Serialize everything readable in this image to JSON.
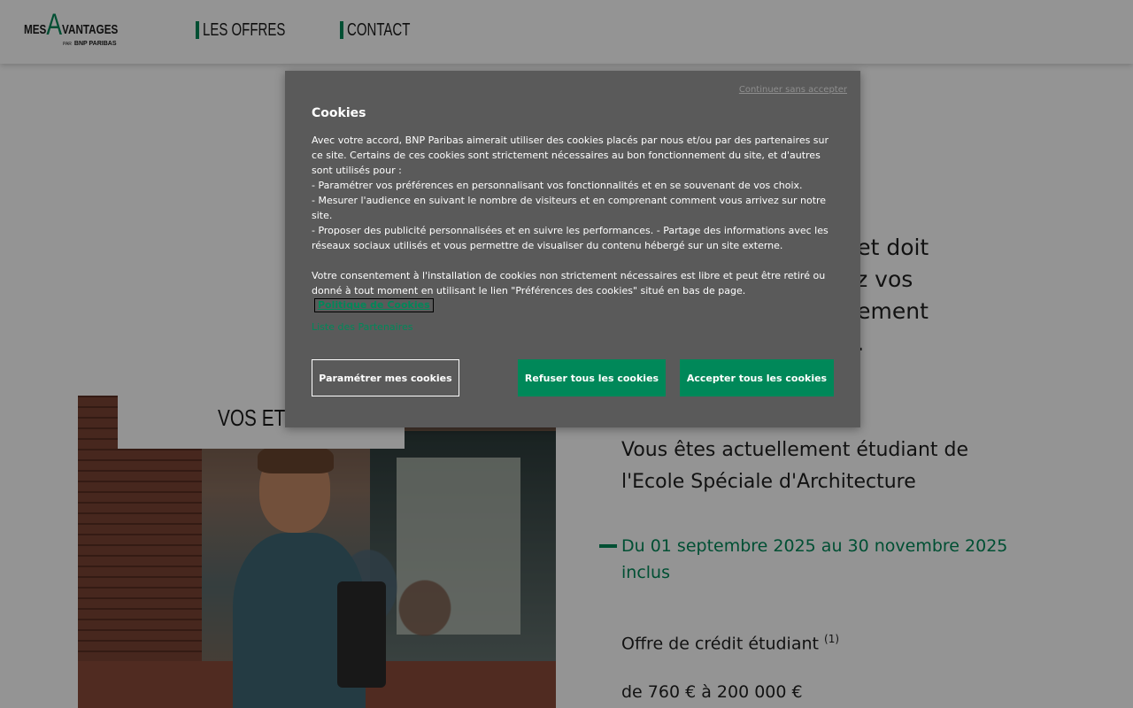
{
  "header": {
    "logo": {
      "mes": "MES",
      "a": "A",
      "vantages": "VANTAGES",
      "par": "PAR",
      "brand": "BNP PARIBAS"
    },
    "nav": [
      {
        "label": "LES OFFRES"
      },
      {
        "label": "CONTACT"
      }
    ]
  },
  "main": {
    "intro_visible": "ge et doit\nifiez vos\nursement\nger.",
    "card_title": "VOS ETUD",
    "status": "Vous êtes actuellement étudiant de l'Ecole Spéciale d'Architecture",
    "dates": "Du 01 septembre 2025 au 30 novembre 2025 inclus",
    "offer": "Offre de  crédit étudiant",
    "offer_note": "(1)",
    "amount": "de 760 € à 200 000 €"
  },
  "cookie_modal": {
    "skip_link": "Continuer sans accepter",
    "title": "Cookies",
    "body": [
      "Avec votre accord, BNP Paribas aimerait utiliser des cookies placés par nous et/ou par des partenaires sur ce site. Certains de ces cookies sont strictement nécessaires au bon fonctionnement du site, et d'autres sont utilisés pour :",
      "- Paramétrer vos préférences en personnalisant vos fonctionnalités et en se souvenant de vos choix.",
      "- Mesurer l'audience en suivant le nombre de visiteurs et en comprenant comment vous arrivez sur notre site.",
      "- Proposer des publicité personnalisées et en suivre les performances. - Partage des informations avec les réseaux sociaux utilisés et vous permettre de visualiser du contenu hébergé sur un site externe.",
      "Votre consentement à l'installation de cookies non strictement nécessaires est libre et peut être retiré ou donné à tout moment en utilisant le lien \"Préférences des cookies\" situé en bas de page."
    ],
    "policy_link": "Politique de Cookies",
    "partners_link": "Liste des Partenaires",
    "buttons": {
      "settings": "Paramétrer mes cookies",
      "refuse": "Refuser tous les cookies",
      "accept": "Accepter tous les cookies"
    }
  },
  "colors": {
    "accent": "#008859",
    "modal_bg": "#5a5a5a"
  }
}
